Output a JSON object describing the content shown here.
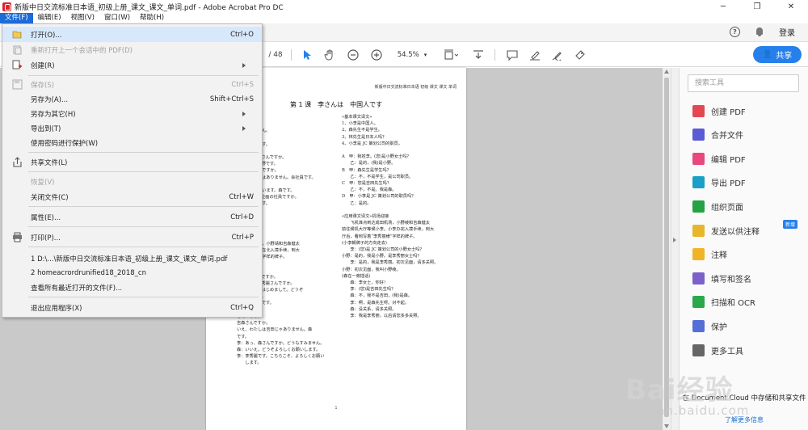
{
  "window": {
    "title": "新版中日交流标准日本语_初级上册_课文_课文_单词.pdf - Adobe Acrobat Pro DC",
    "minimize": "─",
    "restore": "❐",
    "close": "✕"
  },
  "menubar": {
    "file": "文件(F)",
    "edit": "编辑(E)",
    "view": "视图(V)",
    "window": "窗口(W)",
    "help": "帮助(H)"
  },
  "topbar": {
    "help": "?",
    "login": "登录"
  },
  "doctoolbar": {
    "page_total": "/ 48",
    "zoom": "54.5%",
    "share": "共享"
  },
  "filemenu": {
    "items": [
      {
        "label": "打开(O)...",
        "shortcut": "Ctrl+O"
      },
      {
        "label": "重新打开上一个会话中的 PDF(D)",
        "shortcut": ""
      },
      {
        "label": "创建(R)",
        "shortcut": ""
      },
      {
        "label": "保存(S)",
        "shortcut": "Ctrl+S"
      },
      {
        "label": "另存为(A)...",
        "shortcut": "Shift+Ctrl+S"
      },
      {
        "label": "另存为其它(H)",
        "shortcut": ""
      },
      {
        "label": "导出到(T)",
        "shortcut": ""
      },
      {
        "label": "使用密码进行保护(W)",
        "shortcut": ""
      },
      {
        "label": "共享文件(L)",
        "shortcut": ""
      },
      {
        "label": "恢复(V)",
        "shortcut": ""
      },
      {
        "label": "关闭文件(C)",
        "shortcut": "Ctrl+W"
      },
      {
        "label": "属性(E)...",
        "shortcut": "Ctrl+D"
      },
      {
        "label": "打印(P)...",
        "shortcut": "Ctrl+P"
      },
      {
        "label": "1 D:\\...\\新版中日交流标准日本语_初级上册_课文_课文_单词.pdf",
        "shortcut": ""
      },
      {
        "label": "2 homeacrordrunified18_2018_cn",
        "shortcut": ""
      },
      {
        "label": "查看所有最近打开的文件(F)...",
        "shortcut": ""
      },
      {
        "label": "退出应用程序(X)",
        "shortcut": "Ctrl+Q"
      }
    ]
  },
  "document": {
    "header": "新版中日交流标准日本语 初级 课文 课文 单词",
    "lesson_title": "第 1 课　李さんは　中国人です",
    "left_col": "人です。\nではありません。\n人ですか。\n企画の社員です。\n\nまです。小野さんですか。\nそうです。小野です。\n森さんは学生ですか。\nりがくせいではありません。会社員です。\nさんですか。\nいいえ、ちがいます。森です。\n李さんは JC 企画の社員ですか。\nはい、そうです。\n\n\n\n\nた\n北京成田机场，小野靖和吉森健太\n李秀丽，小李在北入境手续，到大\n有“李秀丽様”字样的牌子。\n\n向走去）\nす。小野さんですか。\n小野です。李秀麗さんですか。\n李秀麗です。はじめまして。どうぞ\nお願いします。\nして。小野綾です。\n\nこんにちは。\n吉森さんですか。\nいえ、わたしは吉田じゃありません。森\nです。\n李：あっ、森さんですか。どうもすみません。\n森：いいえ。どうぞよろしくお願いします。\n李：李秀麗です。こちらこそ、よろしくお願い\n　　します。",
    "right_col": "«基本课文译文»\n1、小李是中国人。\n2、森先生不是学生。\n3、林先生是日本人吗？\n4、小李是 JC 策划公司的职员。\n\nA　甲：我姓李。(您)是小野女士吗？\n　　乙：是的，(我)是小野。\nB　甲：森先生是学生吗？\n　　乙：不，不是学生，是公司职员。\nC　甲：您是吉田先生吗？\n　　乙：不，不是。我是森。\nD　甲：小李是 JC 策划公司的职员吗？\n　　乙：是的。\n\n«应用课文译文»机场迎接\n　　飞机准点到达成田机场，小野绫和吉森健太\n前往候机大厅等候小李。小李办完入境手续，到大\n厅后，看到写着“李秀丽様”字样的牌子。\n(小李朝牌子的方向走去)\n　　李：(您)是 JC 策划公司的小野女士吗？\n小野：是的，我是小野。是李秀丽女士吗？\n　　李：是的，我是李秀丽。初次见面，请多关照。\n小野：初次见面，我叫小野绫。\n(森在一旁插话)\n　　森：李女士，你好！\n　　李：(您)是吉田先生吗？\n　　森：不，我不是吉田，(我)是森。\n　　李：啊，是森先生呀。对不起。\n　　森：没关系，请多关照。\n　　李：我是李秀丽，以后请您多多关照。",
    "page_number": "1"
  },
  "rightpane": {
    "search_placeholder": "搜索工具",
    "tools": [
      {
        "label": "创建 PDF",
        "color": "#e34850"
      },
      {
        "label": "合并文件",
        "color": "#5b5bd6"
      },
      {
        "label": "编辑 PDF",
        "color": "#e8477f"
      },
      {
        "label": "导出 PDF",
        "color": "#1aa0c6"
      },
      {
        "label": "组织页面",
        "color": "#27a243"
      },
      {
        "label": "发送以供注释",
        "color": "#e8b62a"
      },
      {
        "label": "注释",
        "color": "#f0b429"
      },
      {
        "label": "填写和签名",
        "color": "#7b61c9"
      },
      {
        "label": "扫描和 OCR",
        "color": "#2aa84a"
      },
      {
        "label": "保护",
        "color": "#5470d6"
      },
      {
        "label": "更多工具",
        "color": "#666666"
      }
    ],
    "new_badge": "新增",
    "cloud_text": "在 Document Cloud 中存储和共享文件",
    "learn_more": "了解更多信息"
  },
  "watermark": {
    "text": "Bai经验",
    "sub": "jingyan.baidu.com"
  }
}
